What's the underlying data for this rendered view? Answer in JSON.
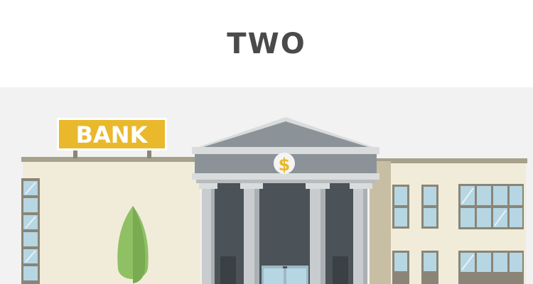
{
  "page": {
    "title": "TWO"
  },
  "illustration": {
    "sign_text": "BANK",
    "emblem_symbol": "$",
    "colors": {
      "background": "#f2f2f2",
      "wall": "#f1ecd9",
      "roof_trim": "#a7a08a",
      "pediment": "#8c9398",
      "pillar": "#c9ccce",
      "sign_yellow": "#e9b92b",
      "tree": "#8fc064",
      "window_glass": "#b6d6e3",
      "window_frame": "#8a8577"
    }
  }
}
